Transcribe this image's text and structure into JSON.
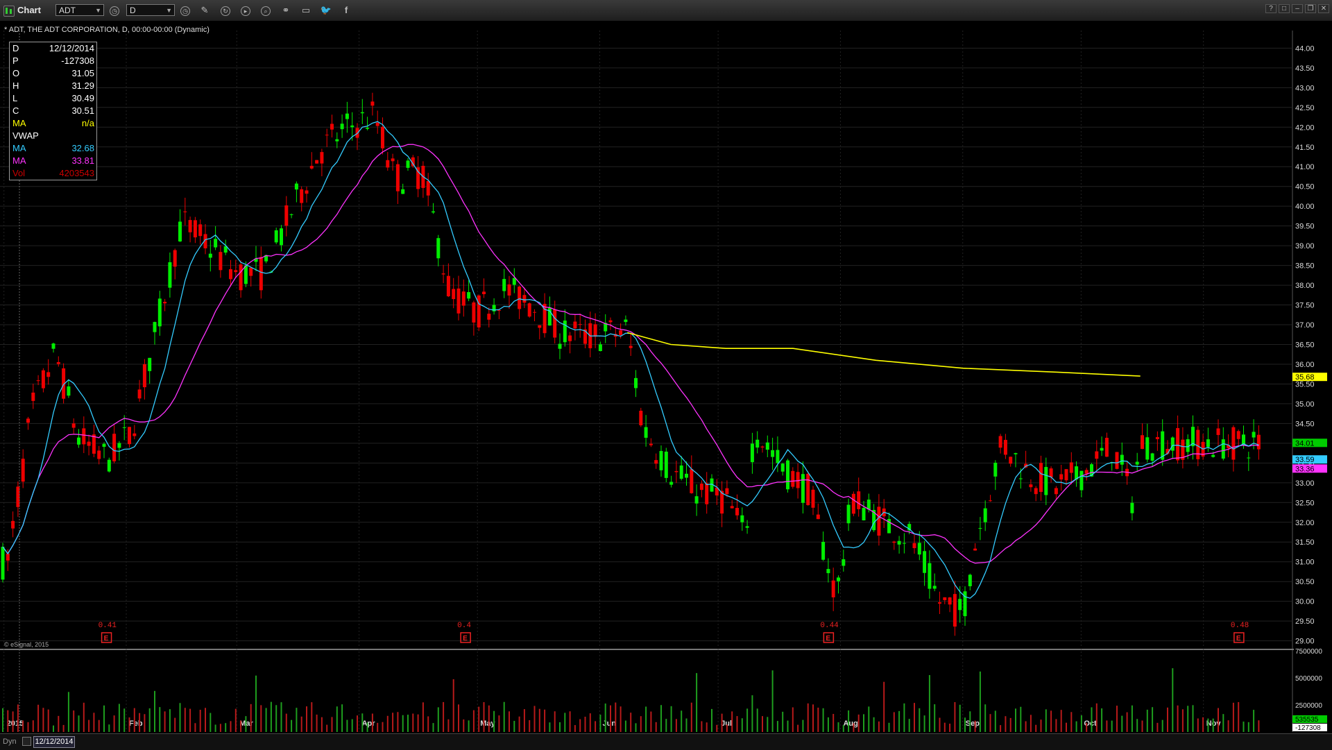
{
  "window": {
    "title": "Chart",
    "symbol": "ADT",
    "interval": "D",
    "controls": [
      "?",
      "□",
      "–",
      "❐",
      "✕"
    ]
  },
  "chart_header": "* ADT, THE ADT CORPORATION, D, 00:00-00:00 (Dynamic)",
  "legend": [
    {
      "label": "D",
      "value": "12/12/2014",
      "color": "#ffffff"
    },
    {
      "label": "P",
      "value": "-127308",
      "color": "#ffffff"
    },
    {
      "label": "O",
      "value": "31.05",
      "color": "#ffffff"
    },
    {
      "label": "H",
      "value": "31.29",
      "color": "#ffffff"
    },
    {
      "label": "L",
      "value": "30.49",
      "color": "#ffffff"
    },
    {
      "label": "C",
      "value": "30.51",
      "color": "#ffffff"
    },
    {
      "label": "MA",
      "value": "n/a",
      "color": "#ffff00"
    },
    {
      "label": "VWAP",
      "value": "",
      "color": "#ffffff"
    },
    {
      "label": "MA",
      "value": "32.68",
      "color": "#33ccff"
    },
    {
      "label": "MA",
      "value": "33.81",
      "color": "#ff33ff"
    },
    {
      "label": "Vol",
      "value": "4203543",
      "color": "#cc0000"
    }
  ],
  "watermark": "© eSignal, 2015",
  "bottom": {
    "dyn_label": "Dyn",
    "cursor_date": "12/12/2014"
  },
  "colors": {
    "up": "#00ee00",
    "down": "#ee0000",
    "ma_fast": "#33ccff",
    "ma_slow": "#ff33ff",
    "ma_long": "#ffff00",
    "grid": "#222222",
    "axis_text": "#dddddd"
  },
  "chart_data": {
    "type": "candlestick",
    "ylim": [
      28.8,
      44.2
    ],
    "y_ticks": [
      "44.00",
      "43.50",
      "43.00",
      "42.50",
      "42.00",
      "41.50",
      "41.00",
      "40.50",
      "40.00",
      "39.50",
      "39.00",
      "38.50",
      "38.00",
      "37.50",
      "37.00",
      "36.50",
      "36.00",
      "35.50",
      "35.00",
      "34.50",
      "34.00",
      "33.50",
      "33.00",
      "32.50",
      "32.00",
      "31.50",
      "31.00",
      "30.50",
      "30.00",
      "29.50",
      "29.00"
    ],
    "x_labels": [
      "2015",
      "Feb",
      "Mar",
      "Apr",
      "May",
      "Jun",
      "Jul",
      "Aug",
      "Sep",
      "Oct",
      "Nov"
    ],
    "price_badges": [
      {
        "value": "35.68",
        "bg": "#ffff00",
        "fg": "#000000"
      },
      {
        "value": "34.01",
        "bg": "#00cc00",
        "fg": "#000000"
      },
      {
        "value": "33.59",
        "bg": "#33ccff",
        "fg": "#000000"
      },
      {
        "value": "33.36",
        "bg": "#ff33ff",
        "fg": "#000000"
      }
    ],
    "series_fast_ma": "cyan",
    "series_slow_ma": "magenta",
    "series_long_ma": "yellow",
    "close_path": [
      [
        "2015-01-02",
        31.0
      ],
      [
        "2015-01-08",
        34.8
      ],
      [
        "2015-01-14",
        36.3
      ],
      [
        "2015-01-20",
        34.1
      ],
      [
        "2015-01-27",
        33.6
      ],
      [
        "2015-02-02",
        34.2
      ],
      [
        "2015-02-08",
        36.6
      ],
      [
        "2015-02-15",
        39.6
      ],
      [
        "2015-02-22",
        39.0
      ],
      [
        "2015-03-01",
        38.3
      ],
      [
        "2015-03-08",
        38.3
      ],
      [
        "2015-03-15",
        39.9
      ],
      [
        "2015-03-22",
        41.4
      ],
      [
        "2015-03-29",
        42.0
      ],
      [
        "2015-04-05",
        42.3
      ],
      [
        "2015-04-10",
        40.7
      ],
      [
        "2015-04-17",
        40.9
      ],
      [
        "2015-04-24",
        37.8
      ],
      [
        "2015-05-01",
        37.3
      ],
      [
        "2015-05-08",
        37.9
      ],
      [
        "2015-05-15",
        37.5
      ],
      [
        "2015-05-22",
        36.8
      ],
      [
        "2015-05-29",
        36.7
      ],
      [
        "2015-06-05",
        36.8
      ],
      [
        "2015-06-08",
        36.9
      ],
      [
        "2015-06-12",
        34.4
      ],
      [
        "2015-06-19",
        33.3
      ],
      [
        "2015-06-26",
        32.8
      ],
      [
        "2015-07-03",
        32.6
      ],
      [
        "2015-07-08",
        31.6
      ],
      [
        "2015-07-10",
        34.4
      ],
      [
        "2015-07-17",
        33.4
      ],
      [
        "2015-07-24",
        32.8
      ],
      [
        "2015-07-31",
        30.1
      ],
      [
        "2015-08-04",
        32.6
      ],
      [
        "2015-08-12",
        32.0
      ],
      [
        "2015-08-19",
        31.6
      ],
      [
        "2015-08-26",
        30.0
      ],
      [
        "2015-09-01",
        29.7
      ],
      [
        "2015-09-04",
        31.4
      ],
      [
        "2015-09-11",
        34.0
      ],
      [
        "2015-09-18",
        33.2
      ],
      [
        "2015-09-25",
        32.9
      ],
      [
        "2015-10-02",
        33.3
      ],
      [
        "2015-10-09",
        33.9
      ],
      [
        "2015-10-14",
        32.6
      ],
      [
        "2015-10-16",
        34.0
      ]
    ],
    "long_ma_path": [
      [
        "2015-06-08",
        36.8
      ],
      [
        "2015-06-19",
        36.5
      ],
      [
        "2015-07-03",
        36.4
      ],
      [
        "2015-07-20",
        36.4
      ],
      [
        "2015-08-10",
        36.1
      ],
      [
        "2015-09-01",
        35.9
      ],
      [
        "2015-09-25",
        35.8
      ],
      [
        "2015-10-16",
        35.7
      ]
    ],
    "earnings": [
      {
        "date": "2015-01-27",
        "value": "0.41"
      },
      {
        "date": "2015-04-28",
        "value": "0.4"
      },
      {
        "date": "2015-07-29",
        "value": "0.44"
      },
      {
        "date": "2015-11-10",
        "value": "0.48"
      }
    ],
    "volume_axis": {
      "ticks": [
        "7500000",
        "5000000",
        "2500000"
      ],
      "badges": [
        {
          "value": "535535",
          "bg": "#00cc00"
        },
        {
          "value": "-127308",
          "bg": "#ffffff"
        }
      ],
      "ylim": [
        0,
        7500000
      ]
    }
  }
}
